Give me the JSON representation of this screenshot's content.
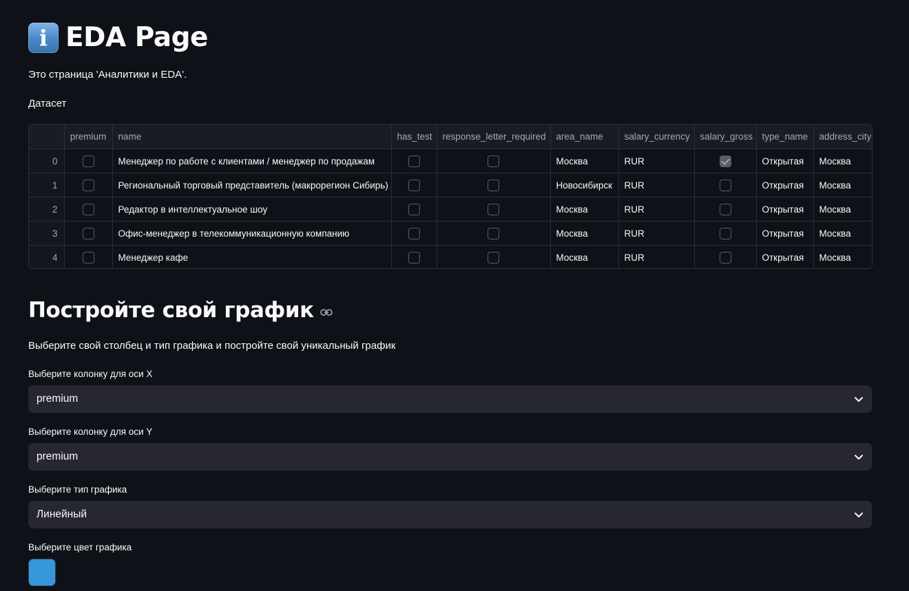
{
  "header": {
    "icon": "information-icon",
    "title": "EDA Page"
  },
  "intro": {
    "description": "Это страница 'Аналитики и EDA'.",
    "dataset_label": "Датасет"
  },
  "table": {
    "columns": [
      "",
      "premium",
      "name",
      "has_test",
      "response_letter_required",
      "area_name",
      "salary_currency",
      "salary_gross",
      "type_name",
      "address_city"
    ],
    "rows": [
      {
        "index": "0",
        "premium": false,
        "name": "Менеджер по работе с клиентами / менеджер по продажам",
        "has_test": false,
        "response_letter_required": false,
        "area_name": "Москва",
        "salary_currency": "RUR",
        "salary_gross": true,
        "type_name": "Открытая",
        "address_city": "Москва"
      },
      {
        "index": "1",
        "premium": false,
        "name": "Региональный торговый представитель (макрорегион Сибирь)",
        "has_test": false,
        "response_letter_required": false,
        "area_name": "Новосибирск",
        "salary_currency": "RUR",
        "salary_gross": false,
        "type_name": "Открытая",
        "address_city": "Москва"
      },
      {
        "index": "2",
        "premium": false,
        "name": "Редактор в интеллектуальное шоу",
        "has_test": false,
        "response_letter_required": false,
        "area_name": "Москва",
        "salary_currency": "RUR",
        "salary_gross": false,
        "type_name": "Открытая",
        "address_city": "Москва"
      },
      {
        "index": "3",
        "premium": false,
        "name": "Офис-менеджер в телекоммуникационную компанию",
        "has_test": false,
        "response_letter_required": false,
        "area_name": "Москва",
        "salary_currency": "RUR",
        "salary_gross": false,
        "type_name": "Открытая",
        "address_city": "Москва"
      },
      {
        "index": "4",
        "premium": false,
        "name": "Менеджер кафе",
        "has_test": false,
        "response_letter_required": false,
        "area_name": "Москва",
        "salary_currency": "RUR",
        "salary_gross": false,
        "type_name": "Открытая",
        "address_city": "Москва"
      }
    ]
  },
  "builder": {
    "title": "Постройте свой график",
    "anchor_icon": "link-icon",
    "description": "Выберите свой столбец и тип графика и постройте свой уникальный график",
    "x_axis": {
      "label": "Выберите колонку для оси X",
      "value": "premium"
    },
    "y_axis": {
      "label": "Выберите колонку для оси Y",
      "value": "premium"
    },
    "chart_type": {
      "label": "Выберите тип графика",
      "value": "Линейный"
    },
    "color": {
      "label": "Выберите цвет графика",
      "value": "#3498db"
    }
  },
  "colors": {
    "background": "#0e1117",
    "select_background": "#262730",
    "text": "#fafafa",
    "muted_text": "#a3a8b8"
  }
}
